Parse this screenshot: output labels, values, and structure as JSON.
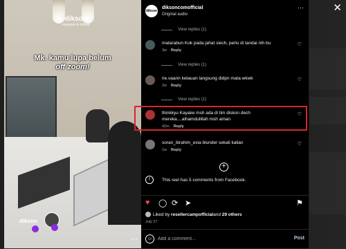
{
  "window": {
    "close_icon": "close-icon"
  },
  "video": {
    "brand": "dikson",
    "brand_sub": "eyewear & optical",
    "caption_line1": "Mk. kamu lupa belum",
    "caption_line2": "off zoom!",
    "brand_bottom": "dikson",
    "more": "⋯"
  },
  "post": {
    "username": "diksoncomofficial",
    "audio": "Original audio",
    "more": "⋯"
  },
  "comments": [
    {
      "type": "view_replies",
      "text": "View replies (1)"
    },
    {
      "type": "comment",
      "user": "matarabun",
      "text": "Kok pada jahat siech, perlu di tandai nih bu",
      "time": "3w",
      "reply": "Reply"
    },
    {
      "type": "view_replies",
      "text": "View replies (1)"
    },
    {
      "type": "comment",
      "user": "rie.vaann",
      "text": "ketauan langsung didpn mata wkwk",
      "time": "2w",
      "reply": "Reply"
    },
    {
      "type": "view_replies",
      "text": "View replies (1)"
    },
    {
      "type": "comment",
      "user": "thinkkyu",
      "text": "Kayake msh ada di tim diskon dech mereka....alhamdulillah msh aman",
      "time": "42m",
      "reply": "Reply"
    },
    {
      "type": "comment",
      "user": "soran_ibrahim_exia",
      "text": "blunder sekali kalian",
      "time": "1w",
      "reply": "Reply"
    }
  ],
  "facebook_note": "This reel has 5 comments from Facebook.",
  "likes": {
    "prefix": "Liked by ",
    "user": "resellercampofficial",
    "mid": " and ",
    "others": "29 others"
  },
  "date": "July 27",
  "add_comment": {
    "placeholder": "Add a comment...",
    "post_label": "Post"
  },
  "colors": {
    "highlight": "#d8262a",
    "like": "#ed4956",
    "panel_bg": "#000000"
  }
}
